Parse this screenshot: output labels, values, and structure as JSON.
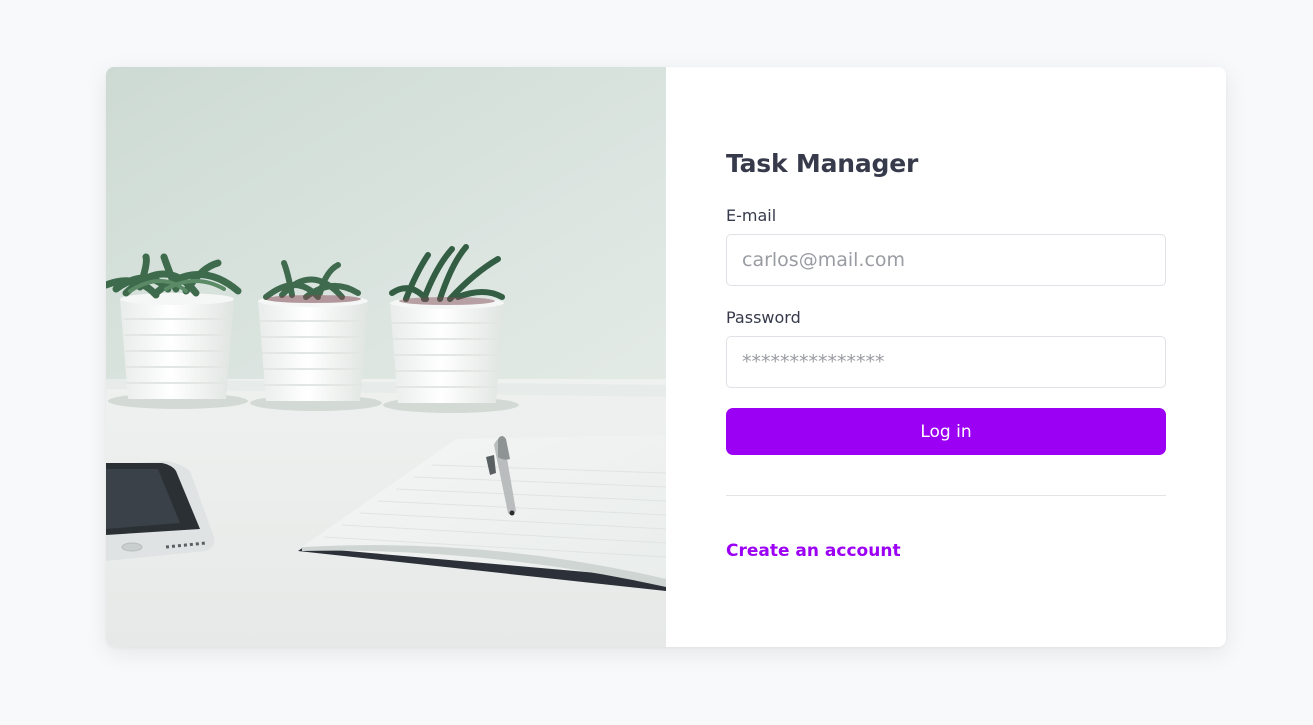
{
  "app": {
    "title": "Task Manager"
  },
  "login_form": {
    "email_label": "E-mail",
    "email_placeholder": "carlos@mail.com",
    "email_value": "",
    "password_label": "Password",
    "password_placeholder": "***************",
    "password_value": "",
    "submit_label": "Log in",
    "create_account_label": "Create an account"
  },
  "colors": {
    "accent": "#9b00f5",
    "heading_text": "#363a4b",
    "page_background": "#f8f9fb",
    "card_background": "#ffffff"
  },
  "illustration": {
    "subject": "desk-photo-succulents-notebook-phone"
  }
}
